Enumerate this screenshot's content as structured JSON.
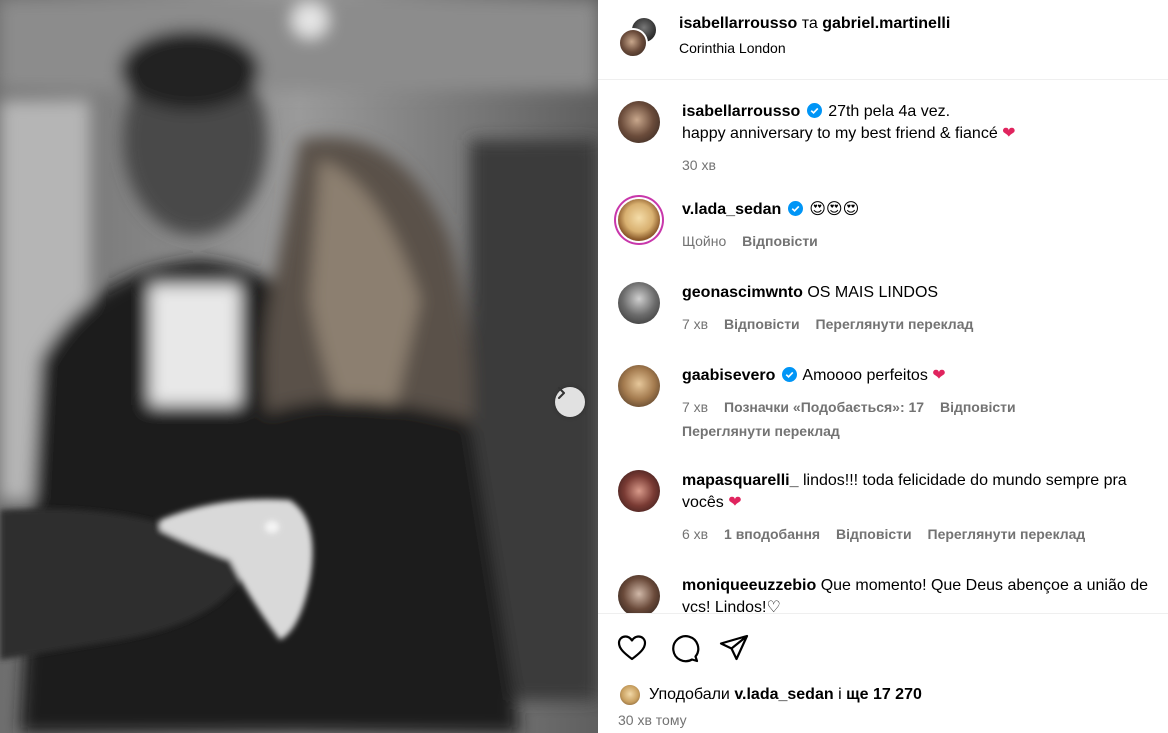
{
  "post": {
    "author": "isabellarrousso",
    "conjunction": "та",
    "coauthor": "gabriel.martinelli",
    "location": "Corinthia London"
  },
  "caption": {
    "username": "isabellarrousso",
    "text_line1": "27th pela 4a vez.",
    "text_line2": "happy anniversary to my best friend & fiancé",
    "heart": "❤",
    "time": "30 хв"
  },
  "comments": [
    {
      "username": "v.lada_sedan",
      "verified": true,
      "text": "😍😍😍",
      "time": "Щойно",
      "reply": "Відповісти"
    },
    {
      "username": "geonascimwnto",
      "verified": false,
      "text": "OS MAIS LINDOS",
      "time": "7 хв",
      "reply": "Відповісти",
      "translate": "Переглянути переклад"
    },
    {
      "username": "gaabisevero",
      "verified": true,
      "text": "Amoooo perfeitos",
      "heart": "❤",
      "time": "7 хв",
      "likes": "Позначки «Подобається»: 17",
      "reply": "Відповісти",
      "translate": "Переглянути переклад"
    },
    {
      "username": "mapasquarelli_",
      "verified": false,
      "text": "lindos!!! toda felicidade do mundo sempre pra vocês",
      "heart": "❤",
      "time": "6 хв",
      "likes": "1 вподобання",
      "reply": "Відповісти",
      "translate": "Переглянути переклад"
    },
    {
      "username": "moniqueeuzzebio",
      "verified": false,
      "text": "Que momento! Que Deus abençoe a união de vcs! Lindos!♡"
    }
  ],
  "likes": {
    "prefix": "Уподобали",
    "user": "v.lada_sedan",
    "middle": "і",
    "rest": "ще 17 270"
  },
  "posted_ago": "30 хв тому",
  "icons": {
    "like": "heart-icon",
    "comment": "comment-icon",
    "share": "share-icon",
    "next": "chevron-right-icon",
    "verified": "verified-badge-icon"
  },
  "colors": {
    "verified": "#0095f6",
    "heart": "#e0245e",
    "secondary_text": "#737373"
  }
}
